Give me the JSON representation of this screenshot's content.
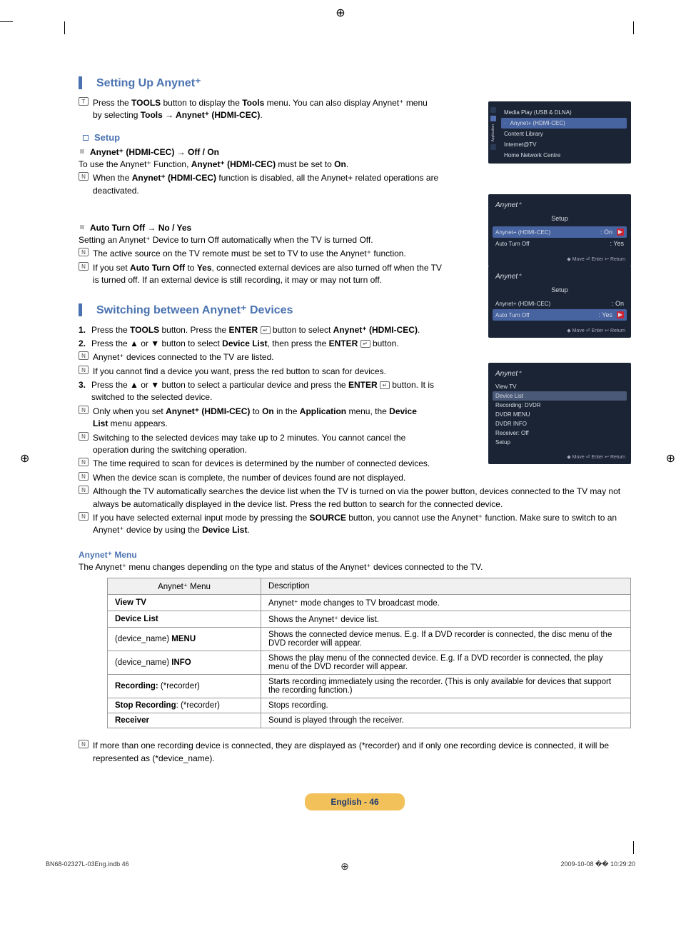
{
  "headings": {
    "setting_up": "Setting Up Anynet⁺",
    "setup": "Setup",
    "hdmi_cec": "Anynet⁺ (HDMI-CEC) → Off / On",
    "auto_turn_off": "Auto Turn Off → No / Yes",
    "switching": "Switching between Anynet⁺ Devices",
    "anynet_menu": "Anynet⁺ Menu"
  },
  "body": {
    "tools_intro_a": "Press the ",
    "tools_bold": "TOOLS",
    "tools_intro_b": " button to display the ",
    "tools_bold2": "Tools",
    "tools_intro_c": " menu. You can also display Anynet⁺ menu by selecting ",
    "tools_path": "Tools → Anynet⁺ (HDMI-CEC)",
    "tools_dot": ".",
    "hdmi_use": "To use the Anynet⁺ Function, ",
    "hdmi_use_b": "Anynet⁺ (HDMI-CEC)",
    "hdmi_use_c": " must be set to ",
    "hdmi_on": "On",
    "hdmi_dot": ".",
    "hdmi_note_a": "When the ",
    "hdmi_note_b": "Anynet⁺ (HDMI-CEC)",
    "hdmi_note_c": " function is disabled, all the Anynet+ related operations are deactivated.",
    "ato_intro": "Setting an Anynet⁺ Device to turn Off automatically when the TV is turned Off.",
    "ato_n1": "The active source on the TV remote must be set to TV to use the Anynet⁺ function.",
    "ato_n2a": "If you set ",
    "ato_n2b": "Auto Turn Off",
    "ato_n2c": " to ",
    "ato_n2d": "Yes",
    "ato_n2e": ", connected external devices are also turned off when the TV is turned off. If an external device is still recording, it may or may not turn off.",
    "sw1a": "Press the ",
    "sw1b": "TOOLS",
    "sw1c": " button. Press the ",
    "sw1d": "ENTER",
    "sw1e": " button to select ",
    "sw1f": "Anynet⁺ (HDMI-CEC)",
    "sw1g": ".",
    "sw2a": "Press the ▲ or ▼ button to select ",
    "sw2b": "Device List",
    "sw2c": ", then press the ",
    "sw2d": "ENTER",
    "sw2e": " button.",
    "sw2n1": "Anynet⁺ devices connected to the TV are listed.",
    "sw2n2": "If you cannot find a device you want, press the red button to scan for devices.",
    "sw3a": "Press the ▲ or ▼ button to select a particular device and press the ",
    "sw3b": "ENTER",
    "sw3c": " button. It is switched to the selected device.",
    "sw3n1a": "Only when you set ",
    "sw3n1b": "Anynet⁺ (HDMI-CEC)",
    "sw3n1c": " to ",
    "sw3n1d": "On",
    "sw3n1e": " in the ",
    "sw3n1f": "Application",
    "sw3n1g": " menu, the ",
    "sw3n1h": "Device List",
    "sw3n1i": " menu appears.",
    "gn1": "Switching to the selected devices may take up to 2 minutes. You cannot cancel the operation during the switching operation.",
    "gn2": "The time required to scan for devices is determined by the number of connected devices.",
    "gn3": "When the device scan is complete, the number of devices found are not displayed.",
    "gn4": "Although the TV automatically searches the device list when the TV is turned on via the power button, devices connected to the TV may not always be automatically displayed in the device list. Press the red button to search for the connected device.",
    "gn5a": "If you have selected external input mode by pressing the ",
    "gn5b": "SOURCE",
    "gn5c": " button, you cannot use the Anynet⁺ function. Make sure to switch to an Anynet⁺ device by using the ",
    "gn5d": "Device List",
    "gn5e": ".",
    "menu_intro": "The Anynet⁺ menu changes depending on the type and status of the Anynet⁺ devices connected to the TV.",
    "foot_note": "If more than one recording device is connected, they are displayed as (*recorder) and if only one recording device is connected, it will be represented as (*device_name)."
  },
  "table": {
    "head_menu": "Anynet⁺ Menu",
    "head_desc": "Description",
    "rows": [
      {
        "m": "View TV",
        "m_bold": true,
        "d": "Anynet⁺ mode changes to TV broadcast mode."
      },
      {
        "m": "Device List",
        "m_bold": true,
        "d": "Shows the Anynet⁺ device list."
      },
      {
        "m": "(device_name) MENU",
        "suffix_bold": "MENU",
        "d": "Shows the connected device menus. E.g. If a DVD recorder is connected, the disc menu of the DVD recorder will appear."
      },
      {
        "m": "(device_name) INFO",
        "suffix_bold": "INFO",
        "d": "Shows the play menu of the connected device. E.g. If a DVD recorder is connected, the play menu of the DVD recorder will appear."
      },
      {
        "m": "Recording: (*recorder)",
        "prefix_bold": "Recording:",
        "d": "Starts recording immediately using the recorder. (This is only available for devices that support the recording function.)"
      },
      {
        "m": "Stop Recording: (*recorder)",
        "prefix_bold": "Stop Recording",
        "d": "Stops recording."
      },
      {
        "m": "Receiver",
        "m_bold": true,
        "d": "Sound is played through the receiver."
      }
    ]
  },
  "osd": {
    "app_items": [
      "Media Play (USB & DLNA)",
      "Anynet+ (HDMI-CEC)",
      "Content Library",
      "Internet@TV",
      "Home Network Centre"
    ],
    "side_label": "Application",
    "brand": "Anynet⁺",
    "setup_title": "Setup",
    "row_hdmi": "Anynet+ (HDMI-CEC)",
    "row_hdmi_val": ": On",
    "row_ato": "Auto Turn Off",
    "row_ato_val": ": Yes",
    "foot": "◆ Move   ⏎ Enter   ↩ Return",
    "list": [
      "View TV",
      "Device List",
      "Recording: DVDR",
      "DVDR MENU",
      "DVDR INFO",
      "Receiver: Off",
      "Setup"
    ]
  },
  "footer": {
    "lang_page": "English - 46",
    "file": "BN68-02327L-03Eng.indb   46",
    "stamp": "2009-10-08   �� 10:29:20"
  }
}
